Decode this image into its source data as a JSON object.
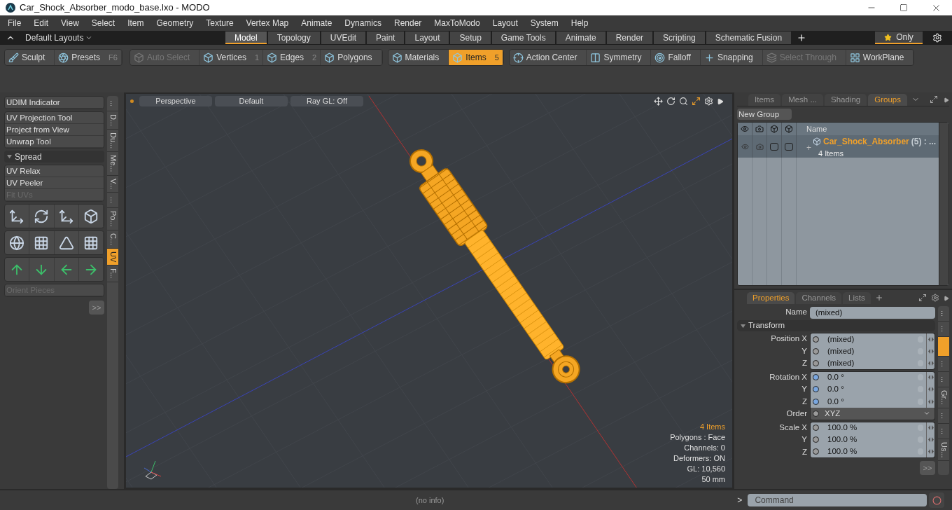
{
  "window": {
    "title": "Car_Shock_Absorber_modo_base.lxo - MODO"
  },
  "menu": [
    "File",
    "Edit",
    "View",
    "Select",
    "Item",
    "Geometry",
    "Texture",
    "Vertex Map",
    "Animate",
    "Dynamics",
    "Render",
    "MaxToModo",
    "Layout",
    "System",
    "Help"
  ],
  "layout_bar": {
    "layouts": "Default Layouts",
    "only": "Only",
    "tabs": [
      {
        "label": "Model",
        "selected": true
      },
      {
        "label": "Topology",
        "selected": false
      },
      {
        "label": "UVEdit",
        "selected": false
      },
      {
        "label": "Paint",
        "selected": false
      },
      {
        "label": "Layout",
        "selected": false
      },
      {
        "label": "Setup",
        "selected": false
      },
      {
        "label": "Game Tools",
        "selected": false
      },
      {
        "label": "Animate",
        "selected": false
      },
      {
        "label": "Render",
        "selected": false
      },
      {
        "label": "Scripting",
        "selected": false
      },
      {
        "label": "Schematic Fusion",
        "selected": false
      }
    ]
  },
  "toolbar": [
    [
      {
        "label": "Sculpt",
        "disabled": false,
        "selected": false
      },
      {
        "label": "Presets",
        "shortcut": "F6",
        "disabled": false,
        "selected": false
      }
    ],
    [
      {
        "label": "Auto Select",
        "disabled": true,
        "selected": false
      },
      {
        "label": "Vertices",
        "shortcut": "1",
        "disabled": false,
        "selected": false
      },
      {
        "label": "Edges",
        "shortcut": "2",
        "disabled": false,
        "selected": false
      },
      {
        "label": "Polygons",
        "disabled": false,
        "selected": false
      }
    ],
    [
      {
        "label": "Materials",
        "disabled": false,
        "selected": false
      },
      {
        "label": "Items",
        "shortcut": "5",
        "disabled": false,
        "selected": true
      }
    ],
    [
      {
        "label": "Action Center",
        "disabled": false,
        "selected": false
      },
      {
        "label": "Symmetry",
        "disabled": false,
        "selected": false
      },
      {
        "label": "Falloff",
        "disabled": false,
        "selected": false
      },
      {
        "label": "Snapping",
        "disabled": false,
        "selected": false
      },
      {
        "label": "Select Through",
        "disabled": true,
        "selected": false
      },
      {
        "label": "WorkPlane",
        "disabled": false,
        "selected": false
      }
    ]
  ],
  "left_panel": {
    "blocks": [
      {
        "kind": "buttons",
        "items": [
          {
            "label": "UDIM Indicator",
            "disabled": false
          }
        ]
      },
      {
        "kind": "buttons",
        "items": [
          {
            "label": "UV Projection Tool",
            "disabled": false
          },
          {
            "label": "Project from View",
            "disabled": false
          },
          {
            "label": "Unwrap Tool",
            "disabled": false
          }
        ]
      },
      {
        "kind": "section",
        "label": "Spread",
        "expanded": true
      },
      {
        "kind": "buttons",
        "items": [
          {
            "label": "UV Relax",
            "disabled": false
          },
          {
            "label": "UV Peeler",
            "disabled": false
          },
          {
            "label": "Fit UVs",
            "disabled": true
          }
        ]
      },
      {
        "kind": "icons"
      },
      {
        "kind": "buttons",
        "items": [
          {
            "label": "Orient Pieces",
            "disabled": true
          }
        ]
      }
    ],
    "more": ">>",
    "side_tabs": [
      {
        "label": "...",
        "selected": false
      },
      {
        "label": "D...",
        "selected": false
      },
      {
        "label": "Du...",
        "selected": false
      },
      {
        "label": "Me...",
        "selected": false
      },
      {
        "label": "V...",
        "selected": false
      },
      {
        "label": "...",
        "selected": false
      },
      {
        "label": "Po...",
        "selected": false
      },
      {
        "label": "C...",
        "selected": false
      },
      {
        "label": "UV",
        "selected": true
      },
      {
        "label": "F...",
        "selected": false
      }
    ]
  },
  "viewport": {
    "buttons": [
      "Perspective",
      "Default",
      "Ray GL: Off"
    ],
    "info": [
      {
        "text": "4 Items",
        "highlight": true
      },
      {
        "text": "Polygons : Face",
        "highlight": false
      },
      {
        "text": "Channels: 0",
        "highlight": false
      },
      {
        "text": "Deformers: ON",
        "highlight": false
      },
      {
        "text": "GL: 10,560",
        "highlight": false
      },
      {
        "text": "50 mm",
        "highlight": false
      }
    ]
  },
  "groups_panel": {
    "tabs": [
      {
        "label": "Items",
        "selected": false
      },
      {
        "label": "Mesh ...",
        "selected": false
      },
      {
        "label": "Shading",
        "selected": false
      },
      {
        "label": "Groups",
        "selected": true
      }
    ],
    "new_group": "New Group",
    "name_column": "Name",
    "rows": [
      {
        "expander": "+",
        "name": "Car_Shock_Absorber",
        "count": "(5) : ...",
        "detail": "4 Items"
      }
    ]
  },
  "properties_panel": {
    "tabs": [
      {
        "label": "Properties",
        "selected": true
      },
      {
        "label": "Channels",
        "selected": false
      },
      {
        "label": "Lists",
        "selected": false
      }
    ],
    "name_label": "Name",
    "name_value": "(mixed)",
    "section": "Transform",
    "section_expanded": true,
    "groups": [
      [
        {
          "label": "Position X",
          "value": "(mixed)",
          "color": "#9a9a9a"
        },
        {
          "label": "Y",
          "value": "(mixed)",
          "color": "#9a9a9a"
        },
        {
          "label": "Z",
          "value": "(mixed)",
          "color": "#9a9a9a"
        }
      ],
      [
        {
          "label": "Rotation X",
          "value": "0.0 °",
          "color": "#7aa7e0"
        },
        {
          "label": "Y",
          "value": "0.0 °",
          "color": "#7aa7e0"
        },
        {
          "label": "Z",
          "value": "0.0 °",
          "color": "#7aa7e0"
        },
        {
          "label": "Order",
          "value": "XYZ",
          "color": "#9a9a9a",
          "kind": "dropdown"
        }
      ],
      [
        {
          "label": "Scale X",
          "value": "100.0 %",
          "color": "#9a9a9a"
        },
        {
          "label": "Y",
          "value": "100.0 %",
          "color": "#9a9a9a"
        },
        {
          "label": "Z",
          "value": "100.0 %",
          "color": "#9a9a9a"
        }
      ]
    ],
    "more": ">>",
    "side_tabs": [
      {
        "label": "...",
        "selected": false
      },
      {
        "label": "...",
        "selected": false
      },
      {
        "selected": true
      },
      {
        "label": "...",
        "selected": false
      },
      {
        "label": "...",
        "selected": false
      },
      {
        "label": "Gr...",
        "selected": false
      },
      {
        "label": "...",
        "selected": false
      },
      {
        "label": "...",
        "selected": false
      },
      {
        "label": "Us...",
        "selected": false
      }
    ]
  },
  "status_bar": {
    "info": "(no info)",
    "prompt": ">",
    "command_placeholder": "Command"
  }
}
